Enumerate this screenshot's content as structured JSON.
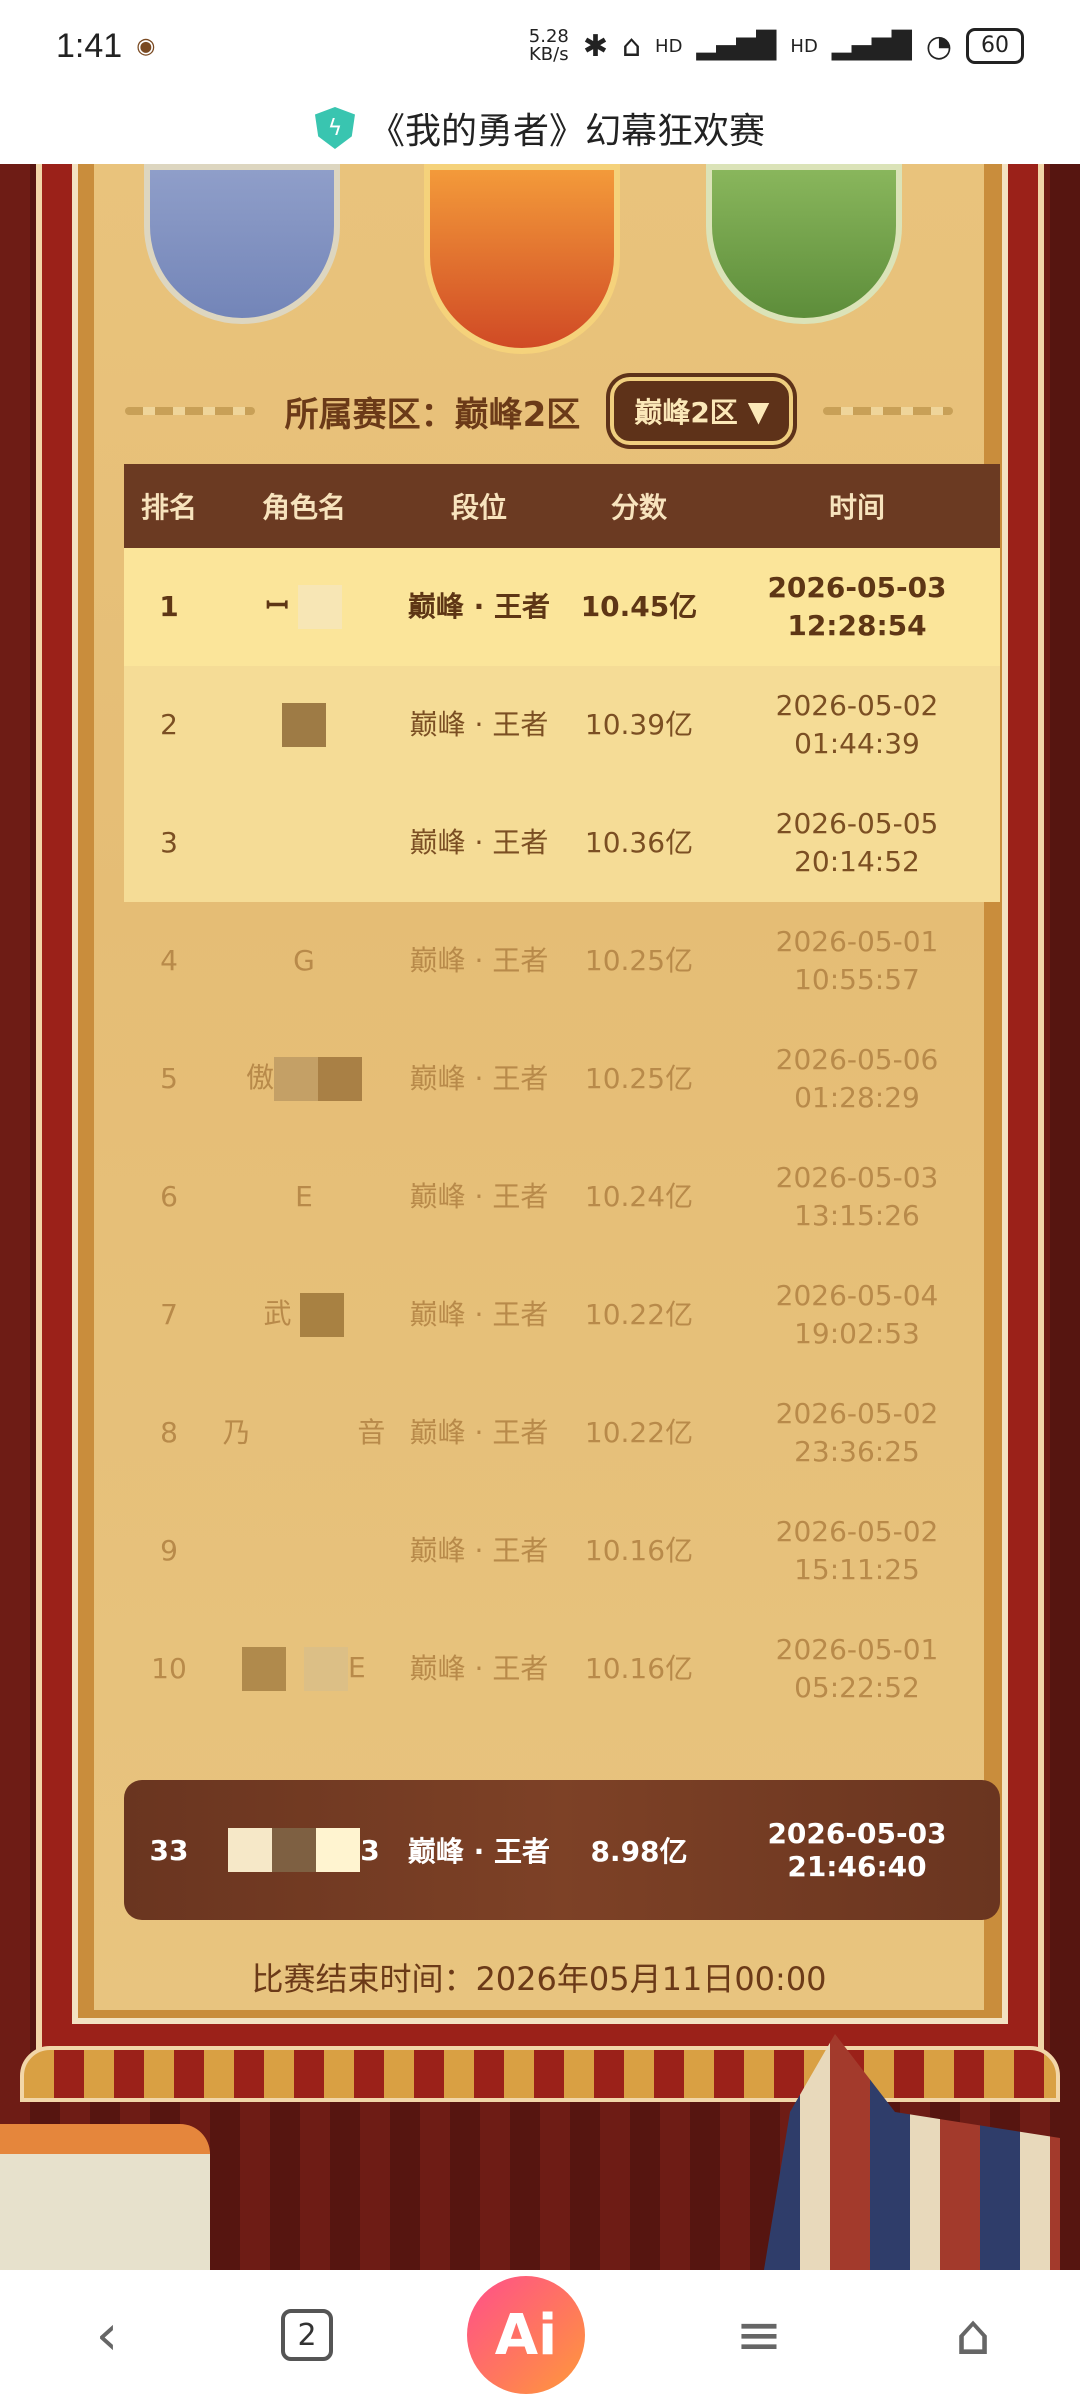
{
  "status": {
    "time": "1:41",
    "speed": "5.28\nKB/s",
    "battery": "60",
    "signal1": "HD",
    "signal2": "HD"
  },
  "page": {
    "title": "《我的勇者》幻幕狂欢赛"
  },
  "zone": {
    "label": "所属赛区：巅峰2区",
    "button": "巅峰2区"
  },
  "table": {
    "headers": [
      "排名",
      "角色名",
      "段位",
      "分数",
      "时间"
    ],
    "rows": [
      {
        "rank": "1",
        "name": "ꟷ",
        "tier": "巅峰 · 王者",
        "score": "10.45亿",
        "date": "2026-05-03",
        "time": "12:28:54"
      },
      {
        "rank": "2",
        "name": "",
        "tier": "巅峰 · 王者",
        "score": "10.39亿",
        "date": "2026-05-02",
        "time": "01:44:39"
      },
      {
        "rank": "3",
        "name": "",
        "tier": "巅峰 · 王者",
        "score": "10.36亿",
        "date": "2026-05-05",
        "time": "20:14:52"
      },
      {
        "rank": "4",
        "name": "G",
        "tier": "巅峰 · 王者",
        "score": "10.25亿",
        "date": "2026-05-01",
        "time": "10:55:57"
      },
      {
        "rank": "5",
        "name": "傲",
        "tier": "巅峰 · 王者",
        "score": "10.25亿",
        "date": "2026-05-06",
        "time": "01:28:29"
      },
      {
        "rank": "6",
        "name": "E",
        "tier": "巅峰 · 王者",
        "score": "10.24亿",
        "date": "2026-05-03",
        "time": "13:15:26"
      },
      {
        "rank": "7",
        "name": "武",
        "tier": "巅峰 · 王者",
        "score": "10.22亿",
        "date": "2026-05-04",
        "time": "19:02:53"
      },
      {
        "rank": "8",
        "name": "乃            音",
        "tier": "巅峰 · 王者",
        "score": "10.22亿",
        "date": "2026-05-02",
        "time": "23:36:25"
      },
      {
        "rank": "9",
        "name": "",
        "tier": "巅峰 · 王者",
        "score": "10.16亿",
        "date": "2026-05-02",
        "time": "15:11:25"
      },
      {
        "rank": "10",
        "name": "E",
        "tier": "巅峰 · 王者",
        "score": "10.16亿",
        "date": "2026-05-01",
        "time": "05:22:52"
      }
    ]
  },
  "my_row": {
    "rank": "33",
    "name": "3",
    "tier": "巅峰 · 王者",
    "score": "8.98亿",
    "date": "2026-05-03",
    "time": "21:46:40"
  },
  "footer": {
    "end_time": "比赛结束时间：2026年05月11日00:00"
  },
  "navbar": {
    "tabs_count": "2",
    "ai_label": "Ai"
  }
}
